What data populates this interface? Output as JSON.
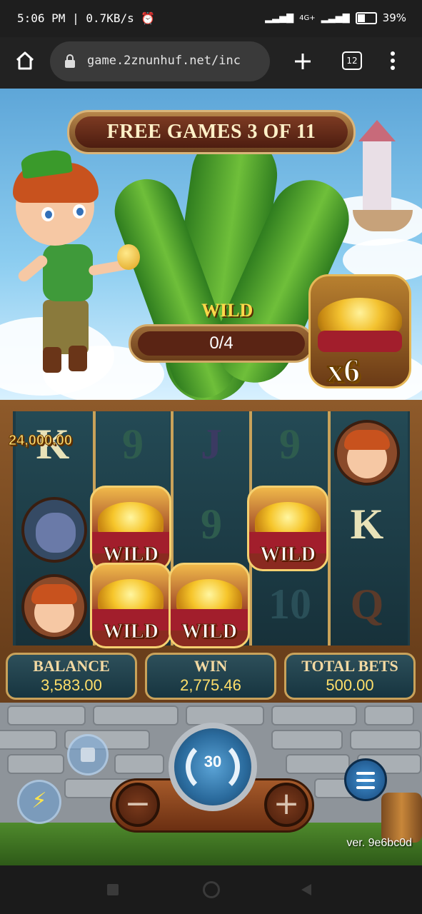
{
  "status_bar": {
    "time": "5:06 PM",
    "speed": "0.7KB/s",
    "network": "4G+",
    "battery": "39%"
  },
  "browser": {
    "url": "game.2znunhuf.net/inc",
    "tab_count": "12"
  },
  "game": {
    "banner": "FREE GAMES 3 OF 11",
    "wild_collector": {
      "label": "WILD",
      "progress": "0/4",
      "multiplier": "x6"
    },
    "win_amount": "24,000.00",
    "reels": [
      [
        "K",
        "ogre",
        "jack"
      ],
      [
        "9",
        "WILD",
        "WILD"
      ],
      [
        "J",
        "9",
        "WILD"
      ],
      [
        "9",
        "WILD",
        "10"
      ],
      [
        "jack",
        "K",
        "Q"
      ]
    ],
    "wild_label": "WILD",
    "panels": {
      "balance_label": "BALANCE",
      "balance_value": "3,583.00",
      "win_label": "WIN",
      "win_value": "2,775.46",
      "bets_label": "TOTAL BETS",
      "bets_value": "500.00"
    },
    "spins_remaining": "30",
    "minus": "−",
    "plus": "+",
    "version": "ver. 9e6bc0d"
  },
  "colors": {
    "gold_text": "#ffdf6a",
    "panel_border": "#c9a25a",
    "banner_text": "#fff1c8"
  }
}
